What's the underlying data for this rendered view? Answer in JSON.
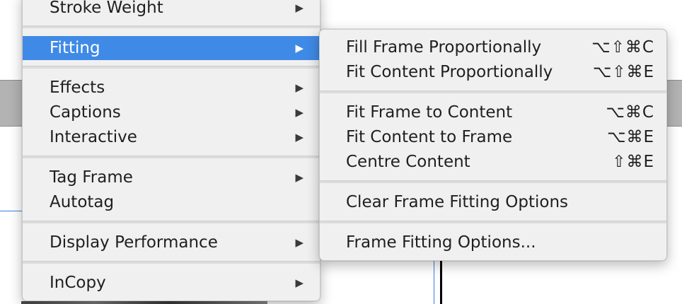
{
  "main_menu": {
    "items": [
      {
        "label": "Stroke Weight"
      },
      {
        "label": "Fitting"
      },
      {
        "label": "Effects"
      },
      {
        "label": "Captions"
      },
      {
        "label": "Interactive"
      },
      {
        "label": "Tag Frame"
      },
      {
        "label": "Autotag"
      },
      {
        "label": "Display Performance"
      },
      {
        "label": "InCopy"
      }
    ],
    "submenu_arrow": "▶",
    "highlighted": "Fitting"
  },
  "fitting_submenu": {
    "items": [
      {
        "label": "Fill Frame Proportionally",
        "shortcut": "⌥⇧⌘C"
      },
      {
        "label": "Fit Content Proportionally",
        "shortcut": "⌥⇧⌘E"
      },
      {
        "label": "Fit Frame to Content",
        "shortcut": "⌥⌘C"
      },
      {
        "label": "Fit Content to Frame",
        "shortcut": "⌥⌘E"
      },
      {
        "label": "Centre Content",
        "shortcut": "⇧⌘E"
      },
      {
        "label": "Clear Frame Fitting Options",
        "shortcut": ""
      },
      {
        "label": "Frame Fitting Options...",
        "shortcut": ""
      }
    ]
  },
  "colors": {
    "highlight": "#3f8ae6",
    "menu_background": "#f0f0f0",
    "canvas_band": "#b3b3b3",
    "guide_line": "#3d7be0"
  }
}
